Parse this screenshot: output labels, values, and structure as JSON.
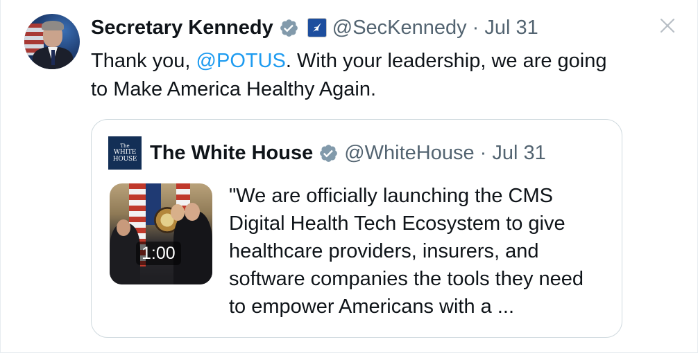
{
  "tweet": {
    "author_name": "Secretary Kennedy",
    "author_handle": "@SecKennedy",
    "separator": "·",
    "date": "Jul 31",
    "text_before": "Thank you, ",
    "mention": "@POTUS",
    "text_after": ". With your leadership, we are going to Make America Healthy Again.",
    "icons": {
      "verified": "verified-badge-icon",
      "affiliation": "hhs-government-badge-icon",
      "close": "close-icon"
    }
  },
  "quote": {
    "author_name": "The White House",
    "author_handle": "@WhiteHouse",
    "separator": "·",
    "date": "Jul 31",
    "avatar_lines": [
      "The",
      "WHITE",
      "HOUSE"
    ],
    "video_duration": "1:00",
    "text": "\"We are officially launching the CMS Digital Health Tech Ecosystem to give healthcare providers, insurers, and software companies the tools they need to empower Americans with a ..."
  },
  "colors": {
    "text_primary": "#0f1419",
    "text_secondary": "#536471",
    "link": "#1d9bf0",
    "verified": "#829aab",
    "border": "#cfd9de"
  }
}
